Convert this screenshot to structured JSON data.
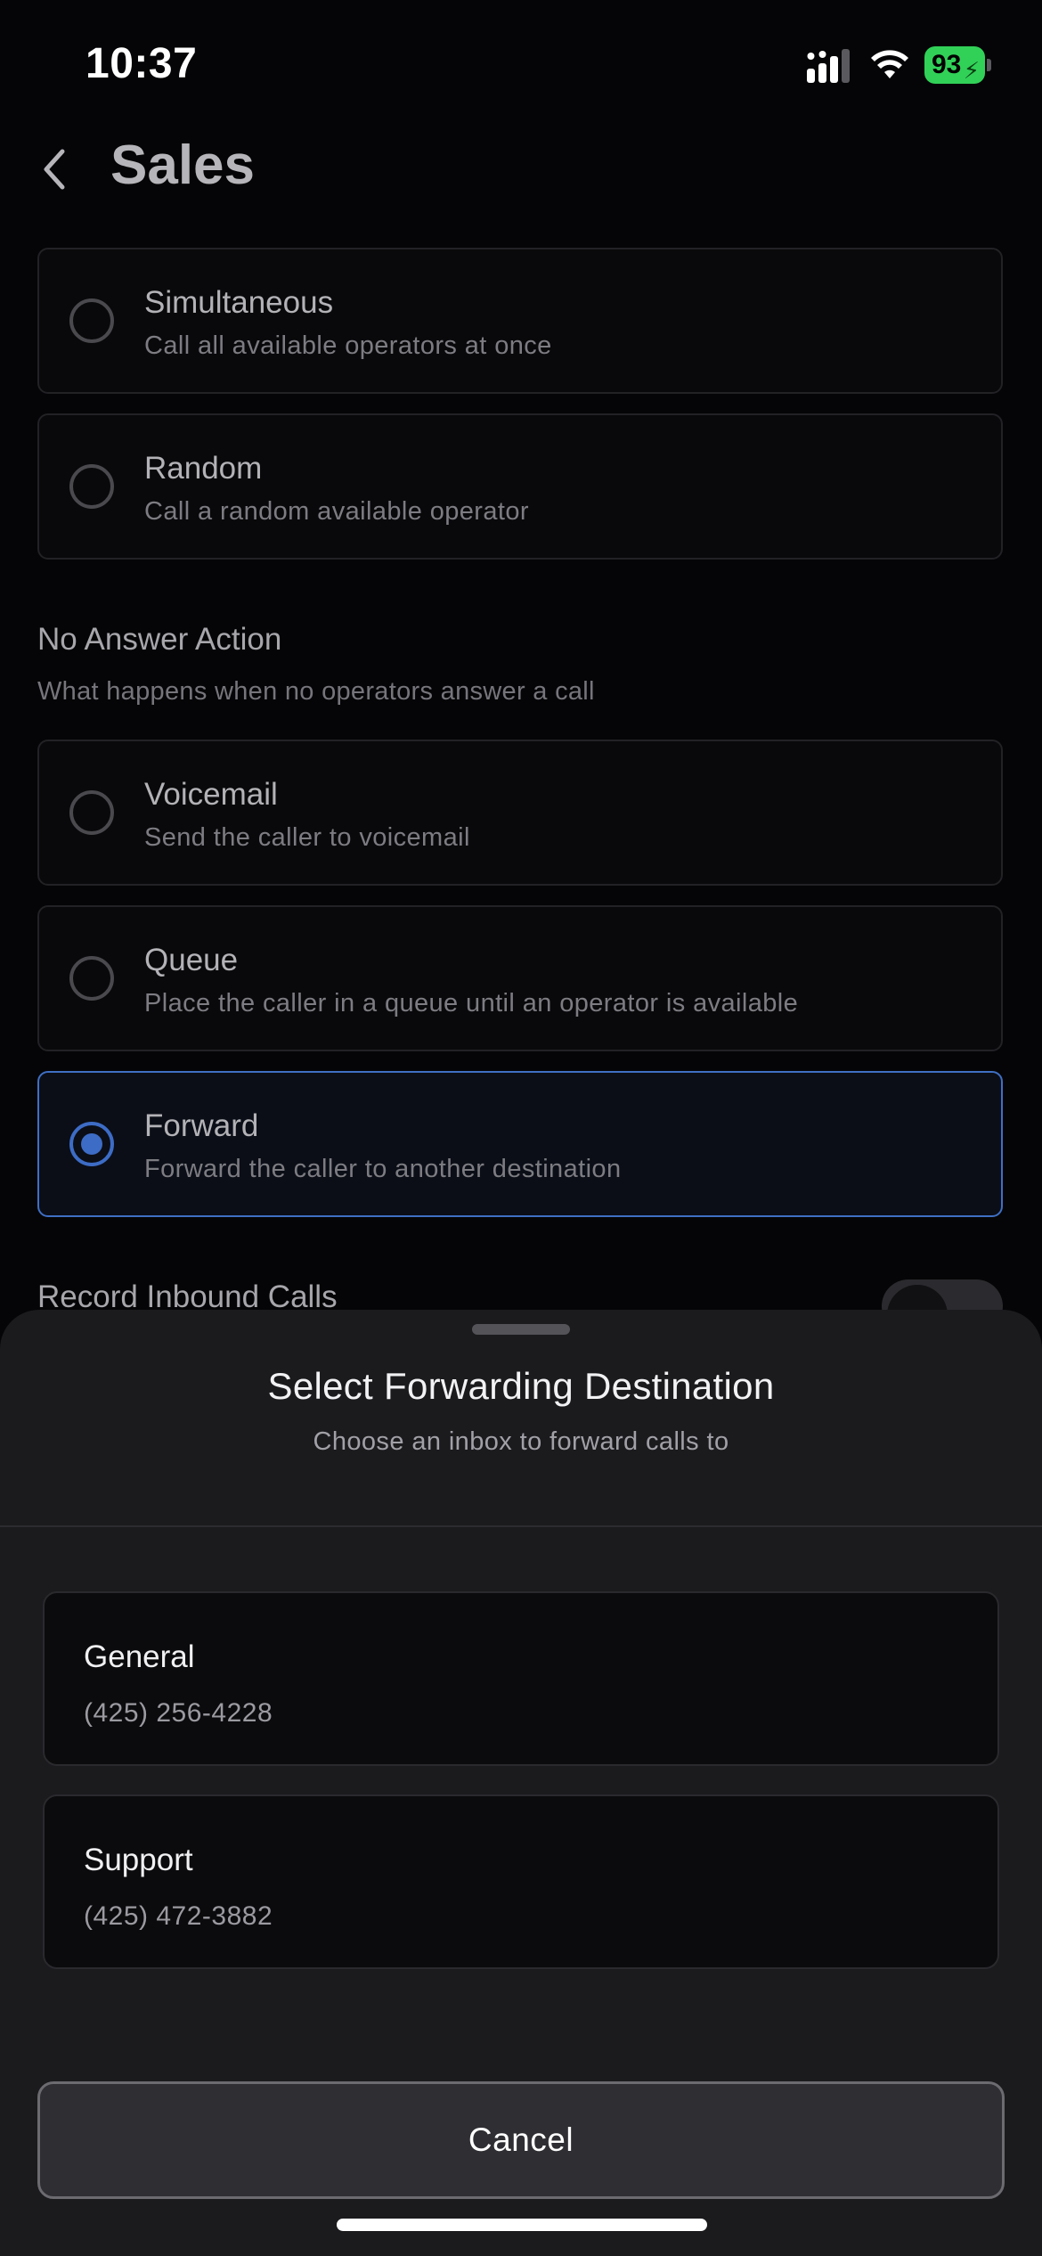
{
  "status_bar": {
    "time": "10:37",
    "battery": "93"
  },
  "header": {
    "title": "Sales"
  },
  "ring_strategy": {
    "options": [
      {
        "title": "Simultaneous",
        "description": "Call all available operators at once",
        "selected": false
      },
      {
        "title": "Random",
        "description": "Call a random available operator",
        "selected": false
      }
    ]
  },
  "no_answer": {
    "heading": "No Answer Action",
    "subheading": "What happens when no operators answer a call",
    "options": [
      {
        "title": "Voicemail",
        "description": "Send the caller to voicemail",
        "selected": false
      },
      {
        "title": "Queue",
        "description": "Place the caller in a queue until an operator is available",
        "selected": false
      },
      {
        "title": "Forward",
        "description": "Forward the caller to another destination",
        "selected": true
      }
    ]
  },
  "record": {
    "label": "Record Inbound Calls"
  },
  "sheet": {
    "title": "Select Forwarding Destination",
    "subtitle": "Choose an inbox to forward calls to",
    "destinations": [
      {
        "name": "General",
        "phone": "(425) 256-4228"
      },
      {
        "name": "Support",
        "phone": "(425) 472-3882"
      }
    ],
    "cancel_label": "Cancel"
  },
  "colors": {
    "accent": "#3d6cc6",
    "battery": "#31d158",
    "background": "#050507",
    "sheet": "#1b1b1e"
  }
}
